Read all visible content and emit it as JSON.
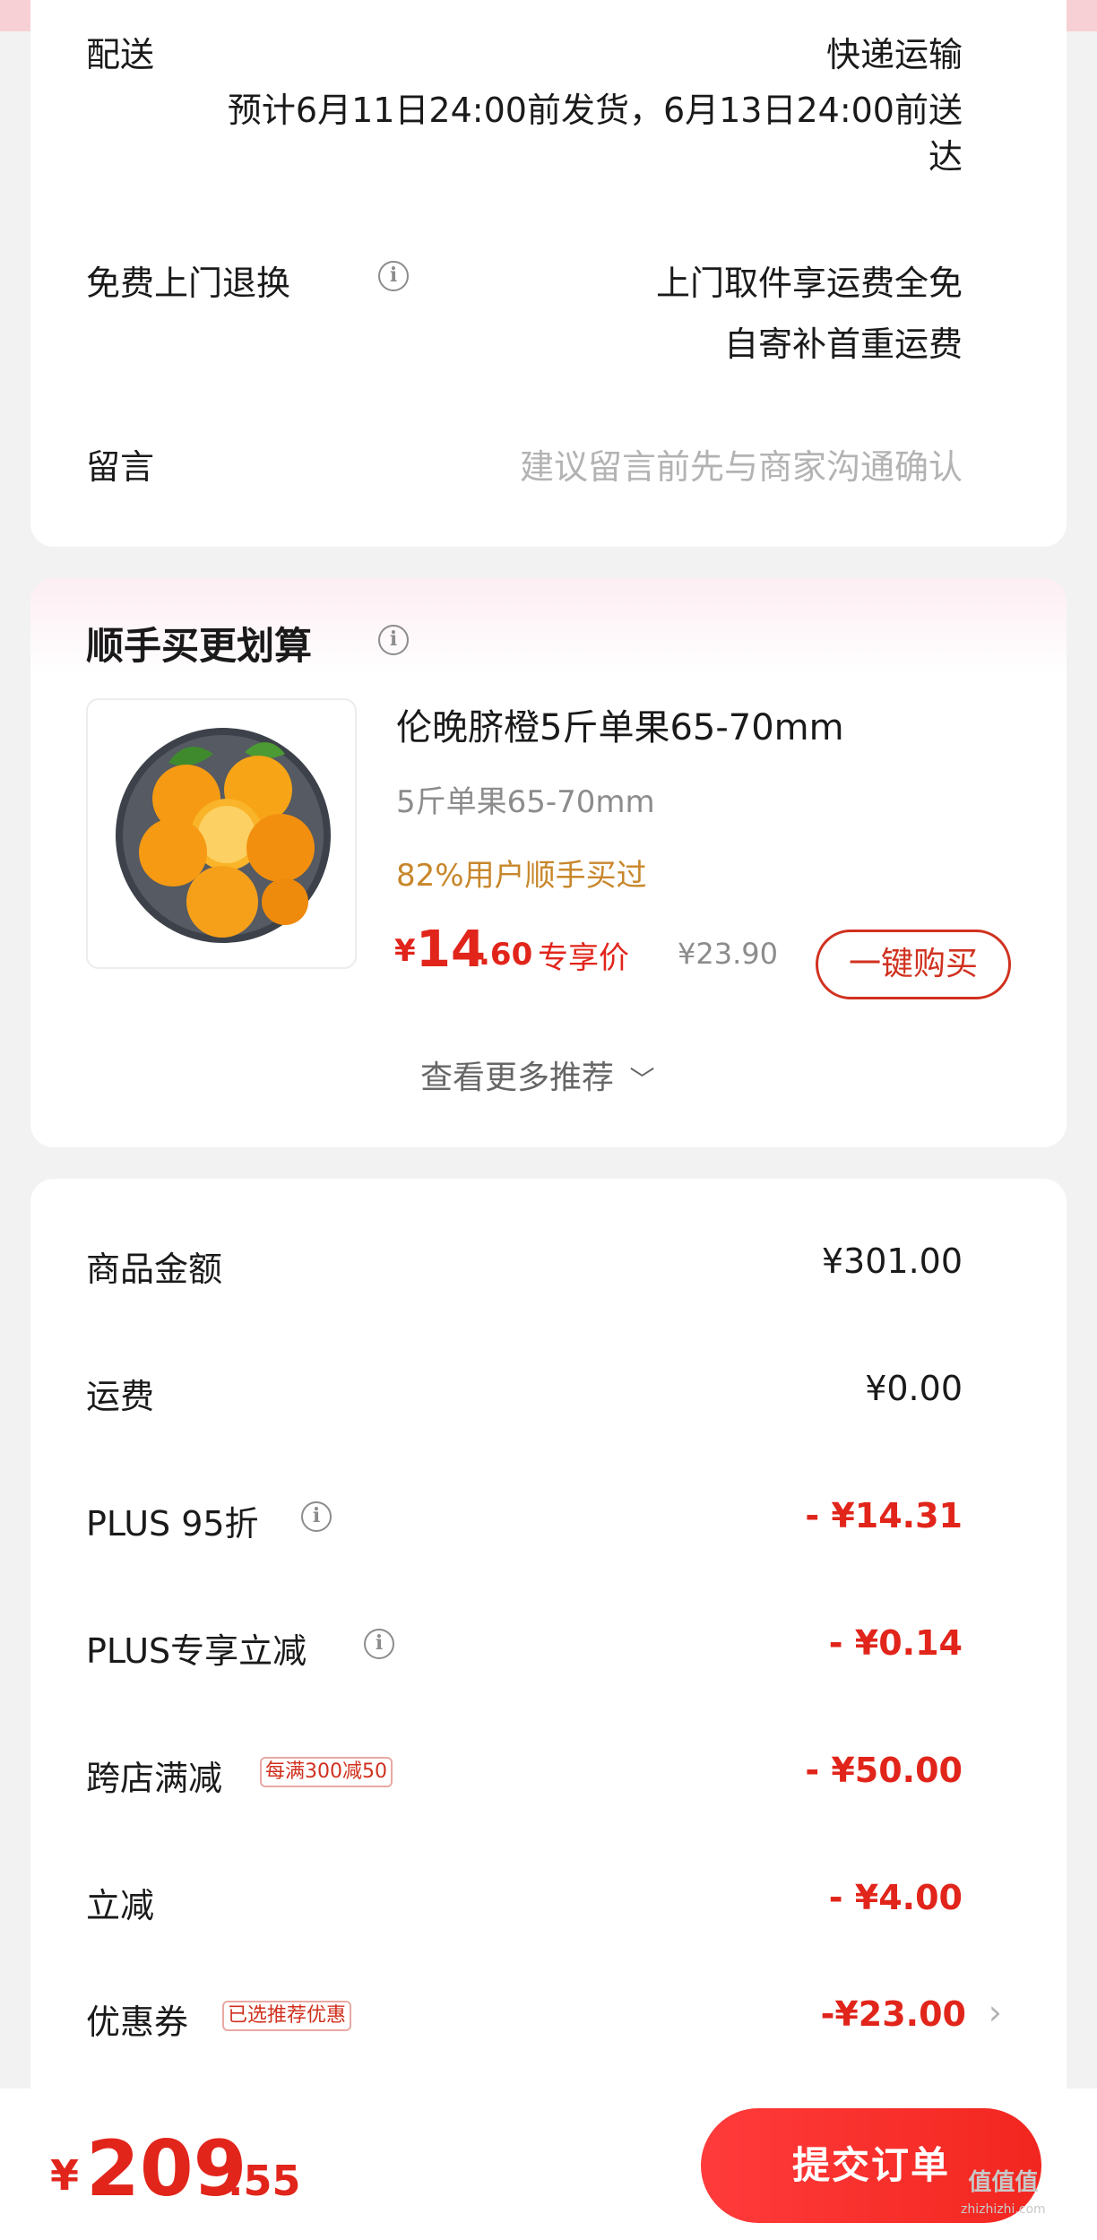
{
  "delivery": {
    "label": "配送",
    "method": "快递运输",
    "estimate_line1": "预计6月11日24:00前发货，6月13日24:00前送",
    "estimate_line2": "达"
  },
  "free_return": {
    "label": "免费上门退换",
    "line1": "上门取件享运费全免",
    "line2": "自寄补首重运费"
  },
  "message": {
    "label": "留言",
    "placeholder": "建议留言前先与商家沟通确认"
  },
  "recommend": {
    "title": "顺手买更划算",
    "product": {
      "name": "伦晚脐橙5斤单果65-70mm",
      "spec": "5斤单果65-70mm",
      "social_proof": "82%用户顺手买过",
      "currency": "¥",
      "price_int": "14",
      "price_dec": ".60",
      "price_tag": "专享价",
      "original_price": "¥23.90",
      "buy_label": "一键购买"
    },
    "more_label": "查看更多推荐"
  },
  "summary": {
    "rows": [
      {
        "label": "商品金额",
        "value": "¥301.00"
      },
      {
        "label": "运费",
        "value": "¥0.00"
      },
      {
        "label": "PLUS 95折",
        "value": "- ¥14.31"
      },
      {
        "label": "PLUS专享立减",
        "value": "- ¥0.14"
      },
      {
        "label": "跨店满减",
        "tag": "每满300减50",
        "value": "- ¥50.00"
      },
      {
        "label": "立减",
        "value": "- ¥4.00"
      },
      {
        "label": "优惠券",
        "tag": "已选推荐优惠",
        "value": "-¥23.00"
      }
    ]
  },
  "footer": {
    "currency": "¥",
    "total_int": "209",
    "total_dec": ".55",
    "submit_label": "提交订单",
    "watermark": "值值值",
    "watermark_sub": "zhizhizhi.com"
  },
  "colors": {
    "accent_red": "#e1251b",
    "social_proof": "#c8872b",
    "page_bg": "#f2f2f2"
  }
}
